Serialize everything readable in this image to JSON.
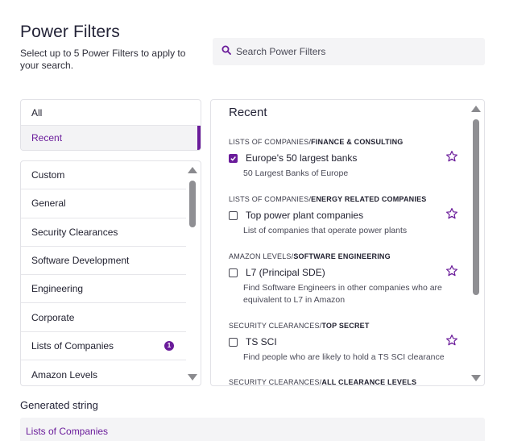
{
  "header": {
    "title": "Power Filters",
    "subtitle": "Select up to 5 Power Filters to apply to your search."
  },
  "search": {
    "placeholder": "Search Power Filters",
    "icon": "search-icon"
  },
  "top_nav": {
    "items": [
      {
        "label": "All",
        "active": false
      },
      {
        "label": "Recent",
        "active": true
      }
    ]
  },
  "categories": {
    "items": [
      {
        "label": "Custom"
      },
      {
        "label": "General"
      },
      {
        "label": "Security Clearances"
      },
      {
        "label": "Software Development"
      },
      {
        "label": "Engineering"
      },
      {
        "label": "Corporate"
      },
      {
        "label": "Lists of Companies",
        "badge": "1"
      },
      {
        "label": "Amazon Levels"
      }
    ]
  },
  "main": {
    "title": "Recent",
    "groups": [
      {
        "crumb_prefix": "LISTS OF COMPANIES/",
        "crumb_strong": "FINANCE & CONSULTING",
        "label": "Europe's 50 largest banks",
        "desc": "50 Largest Banks of Europe",
        "checked": true
      },
      {
        "crumb_prefix": "LISTS OF COMPANIES/",
        "crumb_strong": "ENERGY RELATED COMPANIES",
        "label": "Top power plant companies",
        "desc": "List of companies that operate power plants",
        "checked": false
      },
      {
        "crumb_prefix": "AMAZON LEVELS/",
        "crumb_strong": "SOFTWARE ENGINEERING",
        "label": "L7 (Principal SDE)",
        "desc": "Find Software Engineers in other companies who are equivalent to L7 in Amazon",
        "checked": false
      },
      {
        "crumb_prefix": "SECURITY CLEARANCES/",
        "crumb_strong": "TOP SECRET",
        "label": "TS SCI",
        "desc": "Find people who are likely to hold a TS SCI clearance",
        "checked": false
      },
      {
        "crumb_prefix": "SECURITY CLEARANCES/",
        "crumb_strong": "ALL CLEARANCE LEVELS"
      }
    ]
  },
  "generated": {
    "label": "Generated string",
    "value": "Lists of Companies"
  },
  "colors": {
    "accent": "#6a1b9a",
    "panel_bg": "#f4f4f6",
    "border": "#e2e2e7"
  }
}
